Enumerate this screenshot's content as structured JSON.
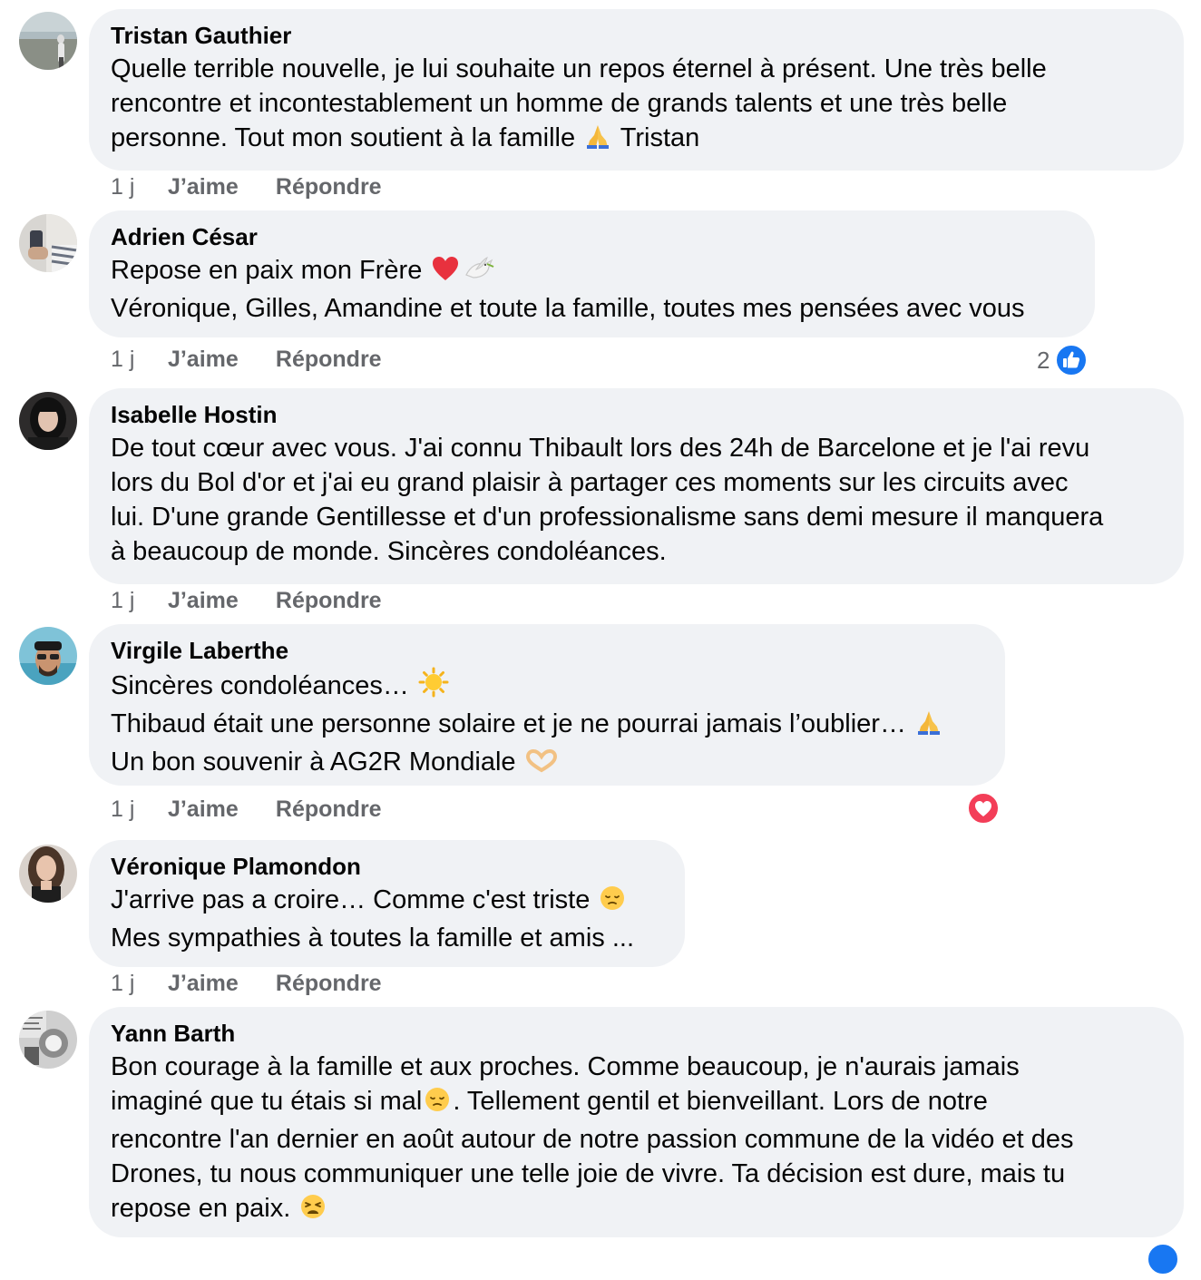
{
  "comments": [
    {
      "author": "Tristan Gauthier",
      "lines": [
        {
          "text": "Quelle terrible nouvelle, je lui souhaite un repos éternel à présent. Une très belle"
        },
        {
          "text": "rencontre et incontestablement un homme de grands talents et une très belle"
        },
        {
          "pre": "personne. Tout mon soutient à la famille ",
          "emoji": "praying-hands-icon",
          "post": " Tristan"
        }
      ],
      "time": "1 j",
      "like": "J’aime",
      "reply": "Répondre"
    },
    {
      "author": "Adrien César",
      "lines": [
        {
          "pre": "Repose en paix mon Frère ",
          "emoji": "red-heart-icon",
          "emoji2": "dove-icon",
          "post": ""
        },
        {
          "text": "Véronique, Gilles, Amandine et toute la famille, toutes mes pensées avec vous"
        }
      ],
      "time": "1 j",
      "like": "J’aime",
      "reply": "Répondre",
      "reaction_count": "2",
      "reaction": "like-reaction-icon"
    },
    {
      "author": "Isabelle Hostin",
      "lines": [
        {
          "text": "De tout cœur avec vous. J'ai connu Thibault lors des 24h de Barcelone et je l'ai revu"
        },
        {
          "text": "lors du Bol d'or et j'ai eu grand plaisir à partager ces moments sur les circuits avec"
        },
        {
          "text": "lui. D'une grande Gentillesse et d'un professionalisme sans demi mesure il manquera"
        },
        {
          "text": "à beaucoup de monde. Sincères condoléances."
        }
      ],
      "time": "1 j",
      "like": "J’aime",
      "reply": "Répondre"
    },
    {
      "author": "Virgile Laberthe",
      "lines": [
        {
          "pre": "Sincères condoléances… ",
          "emoji": "sun-icon",
          "post": ""
        },
        {
          "pre": "Thibaud était une personne solaire et je ne pourrai jamais l’oublier… ",
          "emoji": "praying-hands-icon",
          "post": ""
        },
        {
          "pre": "Un bon souvenir à AG2R Mondiale ",
          "emoji": "heart-hands-icon",
          "post": ""
        }
      ],
      "time": "1 j",
      "like": "J’aime",
      "reply": "Répondre",
      "reaction": "love-reaction-icon"
    },
    {
      "author": "Véronique Plamondon",
      "lines": [
        {
          "pre": "J'arrive pas a croire… Comme c'est triste ",
          "emoji": "pensive-face-icon",
          "post": ""
        },
        {
          "text": "Mes sympathies à toutes la famille et amis ..."
        }
      ],
      "time": "1 j",
      "like": "J’aime",
      "reply": "Répondre"
    },
    {
      "author": "Yann Barth",
      "lines": [
        {
          "text": "Bon courage à la famille et aux proches. Comme beaucoup, je n'aurais jamais"
        },
        {
          "pre": "imaginé que tu étais si mal",
          "emoji": "pensive-face-icon",
          "post": ". Tellement gentil et bienveillant. Lors de notre"
        },
        {
          "text": "rencontre l'an dernier en août autour de notre passion commune de la vidéo et des"
        },
        {
          "text": "Drones, tu nous communiquer une telle joie de vivre. Ta décision est dure, mais tu"
        },
        {
          "pre": "repose en paix. ",
          "emoji": "weary-face-icon",
          "post": ""
        }
      ]
    }
  ],
  "colors": {
    "bubble": "#f0f2f5",
    "meta": "#65676b",
    "like_blue": "#1877f2",
    "love_red": "#f33e58"
  }
}
